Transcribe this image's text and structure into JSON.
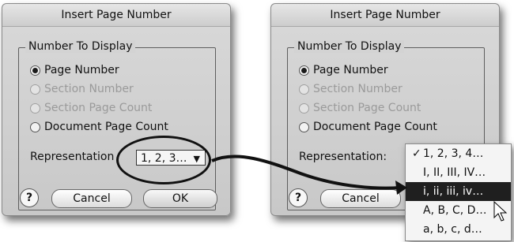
{
  "left_dialog": {
    "title": "Insert Page Number",
    "group_label": "Number To Display",
    "options": [
      "Page Number",
      "Section Number",
      "Section Page Count",
      "Document Page Count"
    ],
    "representation_label": "Representation",
    "representation_value": "1, 2, 3…",
    "help_label": "?",
    "cancel_label": "Cancel",
    "ok_label": "OK"
  },
  "right_dialog": {
    "title": "Insert Page Number",
    "group_label": "Number To Display",
    "options": [
      "Page Number",
      "Section Number",
      "Section Page Count",
      "Document Page Count"
    ],
    "representation_label": "Representation:",
    "help_label": "?",
    "cancel_label": "Cancel"
  },
  "dropdown_menu": {
    "check_mark": "✓",
    "items": [
      "1, 2, 3, 4…",
      "I, II, III, IV…",
      "i, ii, iii, iv…",
      "A, B, C, D…",
      "a, b, c, d…"
    ],
    "checked_index": 0,
    "highlighted_index": 2
  }
}
